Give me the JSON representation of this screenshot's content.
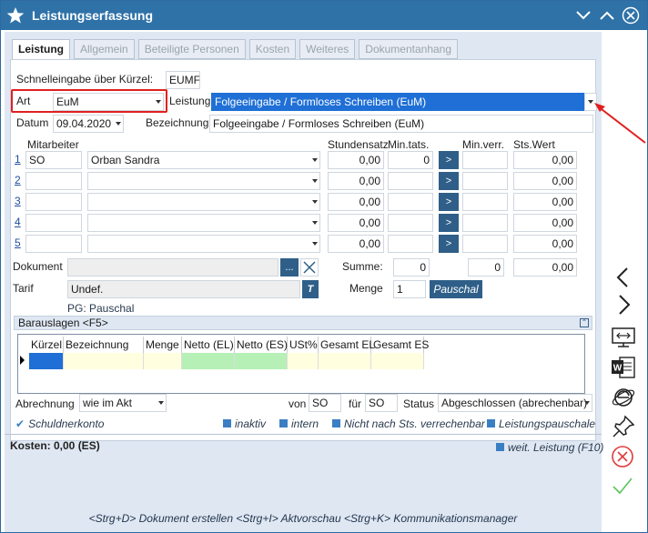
{
  "window": {
    "title": "Leistungserfassung"
  },
  "tabs": [
    "Leistung",
    "Allgemein",
    "Beteiligte Personen",
    "Kosten",
    "Weiteres",
    "Dokumentanhang"
  ],
  "form": {
    "schnell_label": "Schnelleingabe über Kürzel:",
    "schnell_value": "EUMF",
    "art_label": "Art",
    "art_value": "EuM",
    "leistung_label": "Leistung",
    "leistung_value": "Folgeeingabe / Formloses Schreiben (EuM)",
    "datum_label": "Datum",
    "datum_value": "09.04.2020",
    "bezeichnung_label": "Bezeichnung",
    "bezeichnung_value": "Folgeeingabe / Formloses Schreiben (EuM)"
  },
  "columns": {
    "mitarbeiter": "Mitarbeiter",
    "stundensatz": "Stundensatz",
    "mintats": "Min.tats.",
    "minverr": "Min.verr.",
    "stswert": "Sts.Wert"
  },
  "rows": [
    {
      "num": "1",
      "kuerzel": "SO",
      "name": "Orban Sandra",
      "stundensatz": "0,00",
      "mintats": "0",
      "minverr": "",
      "stswert": "0,00"
    },
    {
      "num": "2",
      "kuerzel": "",
      "name": "",
      "stundensatz": "0,00",
      "mintats": "",
      "minverr": "",
      "stswert": "0,00"
    },
    {
      "num": "3",
      "kuerzel": "",
      "name": "",
      "stundensatz": "0,00",
      "mintats": "",
      "minverr": "",
      "stswert": "0,00"
    },
    {
      "num": "4",
      "kuerzel": "",
      "name": "",
      "stundensatz": "0,00",
      "mintats": "",
      "minverr": "",
      "stswert": "0,00"
    },
    {
      "num": "5",
      "kuerzel": "",
      "name": "",
      "stundensatz": "0,00",
      "mintats": "",
      "minverr": "",
      "stswert": "0,00"
    }
  ],
  "arrow_btn": ">",
  "dokument_label": "Dokument",
  "dokument_btn": "...",
  "summe_label": "Summe:",
  "summe_mintats": "0",
  "summe_minverr": "0",
  "summe_stswert": "0,00",
  "tarif_label": "Tarif",
  "tarif_value": "Undef.",
  "tarif_btn": "T",
  "menge_label": "Menge",
  "menge_value": "1",
  "pauschal_btn": "Pauschal",
  "pg_text": "PG: Pauschal",
  "barauslagen": {
    "title": "Barauslagen <F5>",
    "headers": [
      "Kürzel",
      "Bezeichnung",
      "Menge",
      "Netto (EL)",
      "Netto (ES)",
      "USt%",
      "Gesamt EL",
      "Gesamt ES"
    ]
  },
  "bottom": {
    "abrechnung_label": "Abrechnung",
    "abrechnung_value": "wie im Akt",
    "von_label": "von",
    "von_value": "SO",
    "fuer_label": "für",
    "fuer_value": "SO",
    "status_label": "Status",
    "status_value": "Abgeschlossen (abrechenbar)",
    "schuldnerkonto": "Schuldnerkonto",
    "inaktiv": "inaktiv",
    "intern": "intern",
    "nicht_nach": "Nicht nach Sts. verrechenbar",
    "leistungspauschale": "Leistungspauschale",
    "kosten": "Kosten: 0,00 (ES)",
    "weit_leistung": "weit. Leistung (F10)"
  },
  "footer": "<Strg+D> Dokument erstellen <Strg+I> Aktvorschau <Strg+K> Kommunikationsmanager",
  "colors": {
    "titlebar": "#2f72a8",
    "highlight": "#1f6fd6",
    "annotation": "#e02020"
  }
}
